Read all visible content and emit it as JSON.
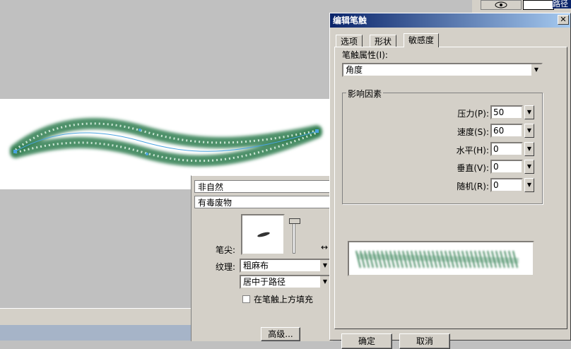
{
  "layers_panel": {
    "layer_name": "路径"
  },
  "inspector": {
    "category_value": "非自然",
    "name_value": "有毒废物",
    "tip_label": "笔尖:",
    "texture_label": "纹理:",
    "texture_value": "粗麻布",
    "placement_value": "居中于路径",
    "fill_over_label": "在笔触上方填充",
    "advanced_button": "高级..."
  },
  "dialog": {
    "title": "编辑笔触",
    "tabs": [
      "选项",
      "形状",
      "敏感度"
    ],
    "active_tab": 2,
    "stroke_property_label": "笔触属性(I):",
    "stroke_property_value": "角度",
    "factors_group_label": "影响因素",
    "factors": [
      {
        "label": "压力(P):",
        "value": "50"
      },
      {
        "label": "速度(S):",
        "value": "60"
      },
      {
        "label": "水平(H):",
        "value": "0"
      },
      {
        "label": "垂直(V):",
        "value": "0"
      },
      {
        "label": "随机(R):",
        "value": "0"
      }
    ],
    "ok_button": "确定",
    "cancel_button": "取消"
  },
  "colors": {
    "stroke_green": "#2e7d4f",
    "selection_blue": "#4aa3df",
    "title_blue": "#0a246a"
  }
}
